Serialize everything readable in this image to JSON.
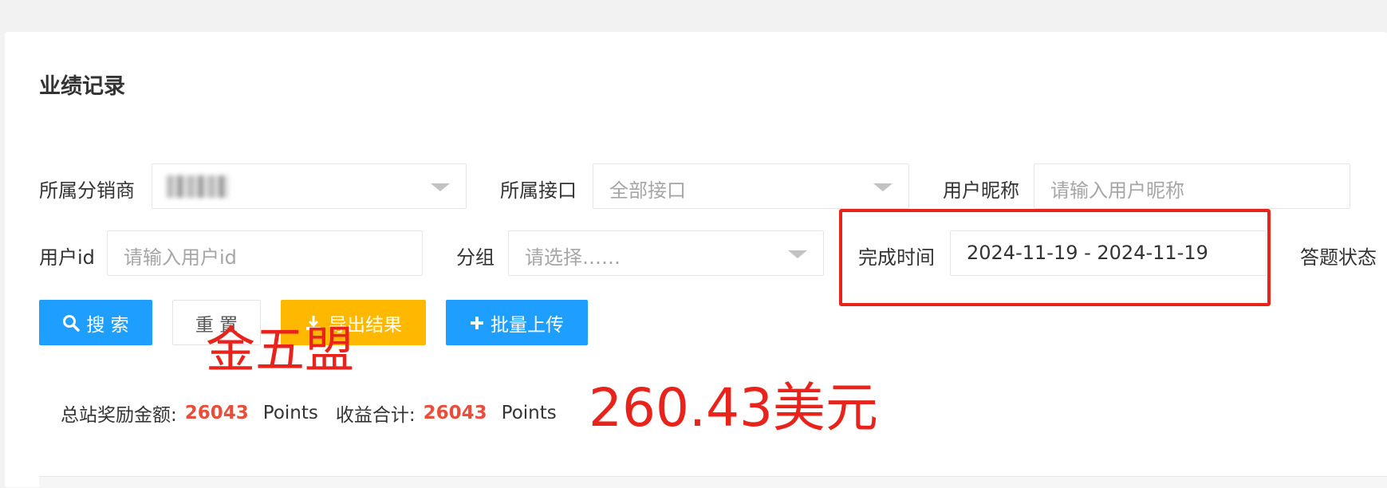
{
  "page": {
    "title": "业绩记录"
  },
  "filters": {
    "distributor": {
      "label": "所属分销商",
      "value": ""
    },
    "interface": {
      "label": "所属接口",
      "placeholder": "全部接口"
    },
    "nickname": {
      "label": "用户昵称",
      "placeholder": "请输入用户昵称"
    },
    "user_id": {
      "label": "用户id",
      "placeholder": "请输入用户id"
    },
    "group": {
      "label": "分组",
      "placeholder": "请选择……"
    },
    "finish_time": {
      "label": "完成时间",
      "value": "2024-11-19 - 2024-11-19"
    },
    "answer_status": {
      "label": "答题状态"
    }
  },
  "buttons": {
    "search": "搜 索",
    "reset": "重 置",
    "export": "导出结果",
    "upload": "批量上传"
  },
  "summary": {
    "reward_label": "总站奖励金额:",
    "reward_value": "26043",
    "reward_unit": "Points",
    "income_label": "收益合计:",
    "income_value": "26043",
    "income_unit": "Points"
  },
  "annotations": {
    "name": "金五盟",
    "amount": "260.43美元"
  },
  "colors": {
    "primary": "#1e9fff",
    "warm": "#ffb800",
    "highlight": "#e8231c",
    "number": "#ea4e3a"
  },
  "icons": [
    "search-icon",
    "download-icon",
    "plus-icon",
    "chevron-down-icon"
  ]
}
